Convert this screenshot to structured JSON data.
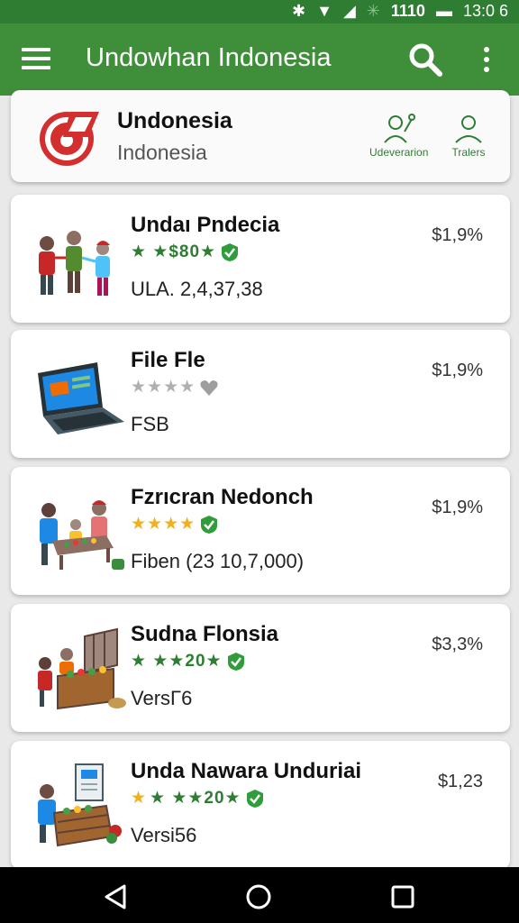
{
  "status_bar": {
    "signal": "1110",
    "time": "13:0 6"
  },
  "app_bar": {
    "title": "Undowhan Indonesia"
  },
  "header": {
    "title": "Undonesia",
    "subtitle": "Indonesia",
    "buttons": [
      {
        "label": "Udeverarion",
        "icon": "person-presenter-icon"
      },
      {
        "label": "Tralers",
        "icon": "person-icon"
      }
    ]
  },
  "items": [
    {
      "name": "Undaı Pndecia",
      "rating_text": "★ ★$80★",
      "rating_color": "#2e7d32",
      "verified": true,
      "subtitle": "ULA. 2,4,37,38",
      "price": "$1,9%",
      "thumb": "people-group"
    },
    {
      "name": "File Fle",
      "rating_text": "★★★★",
      "rating_color": "#b0b0b0",
      "verified": false,
      "subtitle": "FSB",
      "price": "$1,9%",
      "thumb": "laptop"
    },
    {
      "name": "Fzrıcran Nedonch",
      "rating_text": "★★★★",
      "rating_color": "#f2b01e",
      "verified": true,
      "subtitle": "Fiben (23 10,7,000)",
      "price": "$1,9%",
      "thumb": "family-market"
    },
    {
      "name": "Sudna Flonsia",
      "rating_text": "★ ★★20★",
      "rating_color": "#2e7d32",
      "verified": true,
      "subtitle": "VersΓ6",
      "price": "$3,3%",
      "thumb": "market-stall"
    },
    {
      "name": "Unda Nawara Unduriai",
      "rating_text": "★ ★★20★",
      "rating_color": "#2e7d32",
      "verified": true,
      "subtitle": "Versi56",
      "price": "$1,23",
      "thumb": "vendor-stall"
    }
  ]
}
